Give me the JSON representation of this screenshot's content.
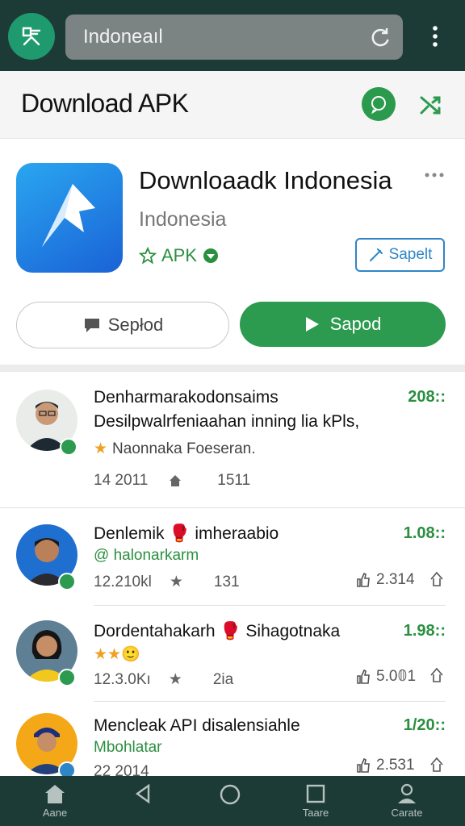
{
  "browser": {
    "url": "Indoneaıl"
  },
  "header": {
    "title": "Download APK"
  },
  "app": {
    "title": "Downloaadk Indonesia",
    "subtitle": "Indonesia",
    "badge": "APK",
    "save_label": "Sapelt",
    "secondary_button": "Sepłod",
    "primary_button": "Sapod"
  },
  "reviews": [
    {
      "name": "Denharmarakodonsaims",
      "text": "Desilpwalrfeniaahan inning lia kPls,",
      "sub": "Naonnaka Foeseran.",
      "score": "208::",
      "meta_a": "14 2011",
      "meta_b": "1511"
    },
    {
      "name": "Denlemik 🥊 imheraabio",
      "sub": "@ halonarkarm",
      "score": "1.08::",
      "meta_a": "12.210kl",
      "meta_b": "131",
      "likes": "2.314"
    },
    {
      "name": "Dordentahakarh 🥊 Sihagotnaka",
      "sub": "★★🙂",
      "score": "1.98::",
      "meta_a": "12.3.0Kı",
      "meta_b": "2ia",
      "likes": "5.0𝟘1"
    },
    {
      "name": "Mencleak API disalensiahle",
      "sub": "Mbohlatar",
      "score": "1/20::",
      "meta_a": "22 2014",
      "likes": "2.531"
    }
  ],
  "navbar": {
    "items": [
      {
        "label": "Aane",
        "icon": "home-icon"
      },
      {
        "label": "",
        "icon": "back-icon"
      },
      {
        "label": "",
        "icon": "circle-home-icon"
      },
      {
        "label": "Taare",
        "icon": "square-icon"
      },
      {
        "label": "Carate",
        "icon": "person-icon"
      }
    ]
  },
  "colors": {
    "accent": "#2c9a4f",
    "bar": "#1d3b36",
    "link": "#2e86c9"
  }
}
